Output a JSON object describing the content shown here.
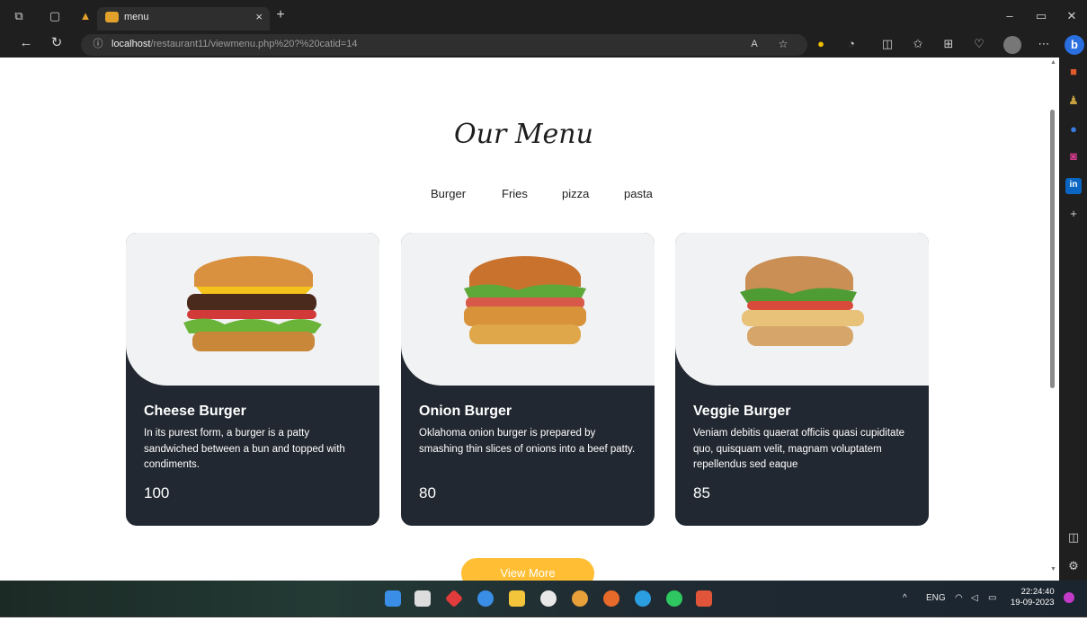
{
  "browser": {
    "tab_title": "menu",
    "url_host": "localhost",
    "url_path": "/restaurant11/viewmenu.php%20?%20catid=14",
    "new_tab_label": "+",
    "tab_close_label": "×"
  },
  "page": {
    "heading": "Our Menu",
    "filters": [
      "Burger",
      "Fries",
      "pizza",
      "pasta"
    ],
    "items": [
      {
        "name": "Cheese Burger",
        "description": "In its purest form, a burger is a patty sandwiched between a bun and topped with condiments.",
        "price": "100"
      },
      {
        "name": "Onion Burger",
        "description": "Oklahoma onion burger is prepared by smashing thin slices of onions into a beef patty.",
        "price": "80"
      },
      {
        "name": "Veggie Burger",
        "description": "Veniam debitis quaerat officiis quasi cupiditate quo, quisquam velit, magnam voluptatem repellendus sed eaque",
        "price": "85"
      }
    ],
    "view_more_label": "View More"
  },
  "taskbar": {
    "language": "ENG",
    "time": "22:24:40",
    "date": "19-09-2023"
  },
  "colors": {
    "accent": "#ffbe33",
    "card_bottom": "#222831",
    "card_top": "#f1f2f3",
    "chrome": "#1f1f1f"
  }
}
